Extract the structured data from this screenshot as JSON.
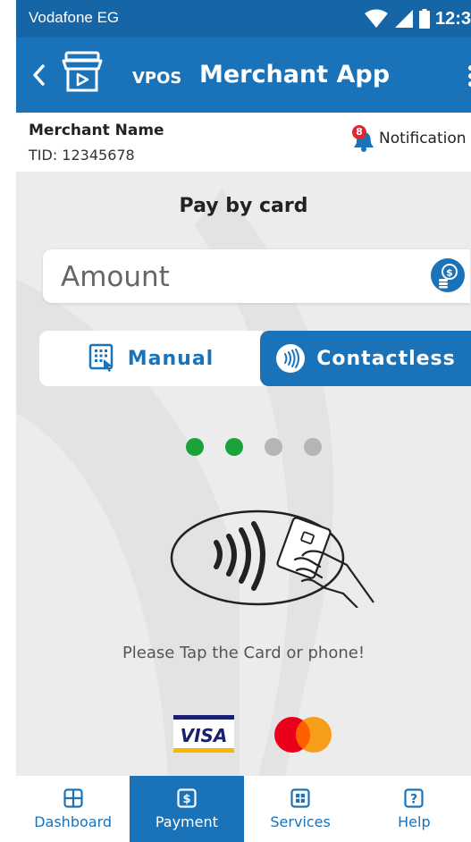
{
  "status_bar": {
    "carrier": "Vodafone EG",
    "time": "12:3"
  },
  "app_bar": {
    "brand": "VPOS",
    "title": "Merchant App"
  },
  "merchant": {
    "name": "Merchant Name",
    "tid": "TID: 12345678",
    "notification_count": "8",
    "notification_label": "Notification"
  },
  "page": {
    "title": "Pay by card"
  },
  "amount": {
    "placeholder": "Amount",
    "value": ""
  },
  "mode_toggle": {
    "manual": "Manual",
    "contactless": "Contactless",
    "selected": "Contactless"
  },
  "progress": {
    "steps_total": 4,
    "steps_done": 2,
    "done_color": "#1aa33a",
    "pending_color": "#b5b5b5"
  },
  "tap": {
    "message": "Please Tap the Card or phone!"
  },
  "card_brands": [
    "VISA",
    "Mastercard"
  ],
  "bottom_nav": [
    {
      "label": "Dashboard",
      "icon": "dashboard-icon",
      "active": false
    },
    {
      "label": "Payment",
      "icon": "payment-icon",
      "active": true
    },
    {
      "label": "Services",
      "icon": "services-icon",
      "active": false
    },
    {
      "label": "Help",
      "icon": "help-icon",
      "active": false
    }
  ],
  "colors": {
    "primary": "#1a73b9",
    "status_bar": "#1565a7",
    "background": "#ececec"
  }
}
